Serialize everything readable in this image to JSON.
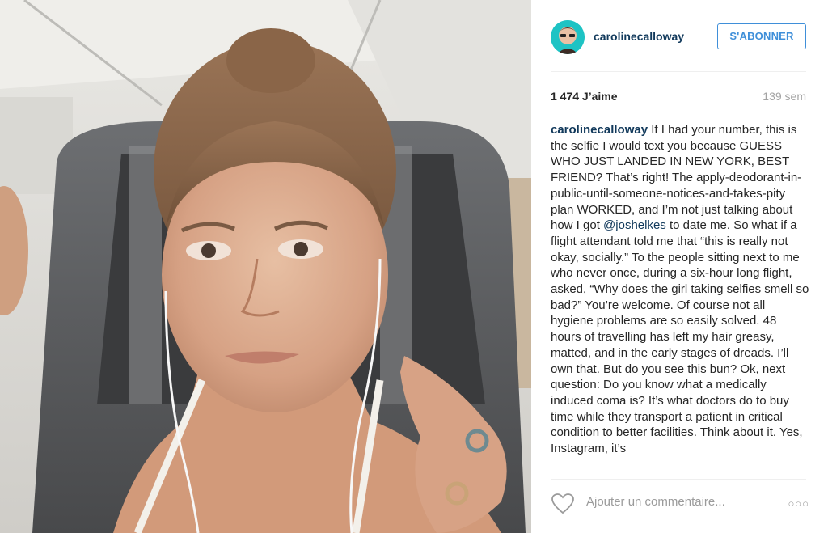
{
  "post": {
    "username": "carolinecalloway",
    "follow_label": "S'ABONNER",
    "likes": "1 474 J’aime",
    "time_ago": "139 sem",
    "caption_user": "carolinecalloway",
    "caption_part1": " If I had your number, this is the selfie I would text you because GUESS WHO JUST LANDED IN NEW YORK, BEST FRIEND? That’s right! The apply-deodorant-in-public-until-someone-notices-and-takes-pity plan WORKED, and I’m not just talking about how I got ",
    "caption_mention": "@joshelkes",
    "caption_part2": " to date me. So what if a flight attendant told me that “this is really not okay, socially.” To the people sitting next to me who never once, during a six-hour long flight, asked, “Why does the girl taking selfies smell so bad?” You’re welcome. Of course not all hygiene problems are so easily solved. 48 hours of travelling has left my hair greasy, matted, and in the early stages of dreads. I’ll own that. But do you see this bun? Ok, next question: Do you know what a medically induced coma is? It’s what doctors do to buy time while they transport a patient in critical condition to better facilities. Think about it. Yes, Instagram, it’s",
    "comment_placeholder": "Ajouter un commentaire...",
    "more_label": "○○○"
  },
  "icons": {
    "like": "heart-outline-icon",
    "more": "ellipsis-icon"
  },
  "colors": {
    "username": "#11395b",
    "follow_accent": "#3f8fd9",
    "meta_gray": "#a3a3a3",
    "avatar_ring": "#1ec3c4"
  }
}
